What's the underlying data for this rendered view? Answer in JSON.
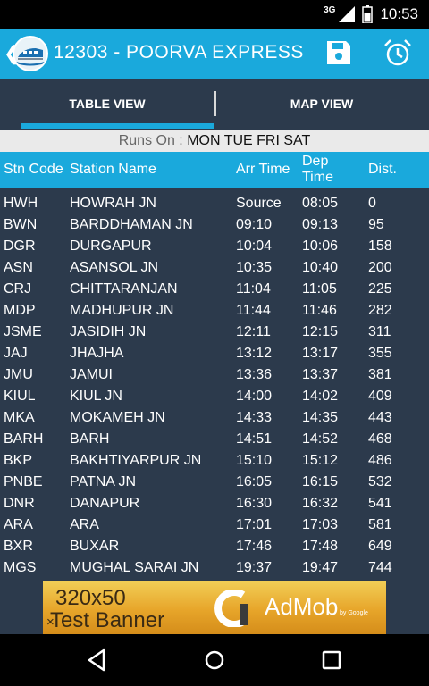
{
  "status_bar": {
    "network": "3G",
    "time": "10:53"
  },
  "app_bar": {
    "title": "12303 - POORVA EXPRESS"
  },
  "tabs": [
    {
      "label": "TABLE VIEW",
      "selected": true
    },
    {
      "label": "MAP VIEW",
      "selected": false
    }
  ],
  "runs_on": {
    "label": "Runs On :",
    "days": "MON TUE FRI SAT"
  },
  "table": {
    "headers": {
      "code": "Stn Code",
      "name": "Station Name",
      "arr": "Arr Time",
      "dep_1": "Dep",
      "dep_2": "Time",
      "dist": "Dist."
    },
    "rows": [
      [
        "HWH",
        "HOWRAH JN",
        "Source",
        "08:05",
        "0"
      ],
      [
        "BWN",
        "BARDDHAMAN JN",
        "09:10",
        "09:13",
        "95"
      ],
      [
        "DGR",
        "DURGAPUR",
        "10:04",
        "10:06",
        "158"
      ],
      [
        "ASN",
        "ASANSOL JN",
        "10:35",
        "10:40",
        "200"
      ],
      [
        "CRJ",
        "CHITTARANJAN",
        "11:04",
        "11:05",
        "225"
      ],
      [
        "MDP",
        "MADHUPUR JN",
        "11:44",
        "11:46",
        "282"
      ],
      [
        "JSME",
        "JASIDIH JN",
        "12:11",
        "12:15",
        "311"
      ],
      [
        "JAJ",
        "JHAJHA",
        "13:12",
        "13:17",
        "355"
      ],
      [
        "JMU",
        "JAMUI",
        "13:36",
        "13:37",
        "381"
      ],
      [
        "KIUL",
        "KIUL JN",
        "14:00",
        "14:02",
        "409"
      ],
      [
        "MKA",
        "MOKAMEH JN",
        "14:33",
        "14:35",
        "443"
      ],
      [
        "BARH",
        "BARH",
        "14:51",
        "14:52",
        "468"
      ],
      [
        "BKP",
        "BAKHTIYARPUR JN",
        "15:10",
        "15:12",
        "486"
      ],
      [
        "PNBE",
        "PATNA JN",
        "16:05",
        "16:15",
        "532"
      ],
      [
        "DNR",
        "DANAPUR",
        "16:30",
        "16:32",
        "541"
      ],
      [
        "ARA",
        "ARA",
        "17:01",
        "17:03",
        "581"
      ],
      [
        "BXR",
        "BUXAR",
        "17:46",
        "17:48",
        "649"
      ],
      [
        "MGS",
        "MUGHAL SARAI JN",
        "19:37",
        "19:47",
        "744"
      ]
    ]
  },
  "ad": {
    "size": "320x50",
    "test": "Test Banner",
    "close": "×",
    "brand": "AdMob",
    "by": "by Google"
  },
  "nav": {
    "back": "back-icon",
    "home": "home-icon",
    "recents": "recents-icon"
  },
  "colors": {
    "accent": "#1aa9dc",
    "background": "#2c3a4c",
    "runs_on_bg": "#eaeaea"
  }
}
